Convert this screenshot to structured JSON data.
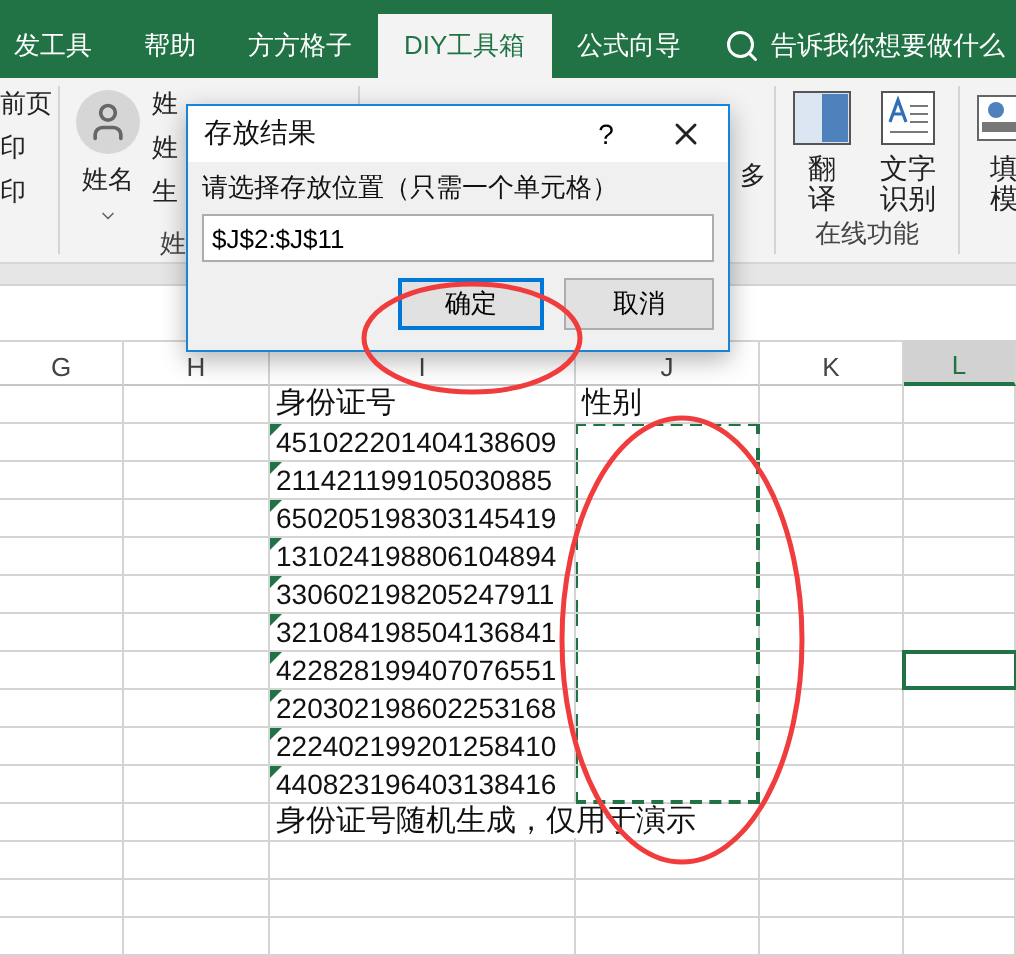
{
  "ribbon_tabs": [
    {
      "label": "发工具",
      "selected": false
    },
    {
      "label": "帮助",
      "selected": false
    },
    {
      "label": "方方格子",
      "selected": false
    },
    {
      "label": "DIY工具箱",
      "selected": true
    },
    {
      "label": "公式向导",
      "selected": false
    }
  ],
  "search": {
    "placeholder": "告诉我你想要做什么"
  },
  "ribbon": {
    "left_items": [
      "前页",
      "印",
      "印"
    ],
    "name_button": "姓名",
    "name_items": [
      "姓",
      "姓",
      "生"
    ],
    "name_group": "姓",
    "more_label": "多",
    "online_buttons": [
      {
        "label": "翻译",
        "kind": "translate"
      },
      {
        "label": "文字识别",
        "kind": "ocr"
      }
    ],
    "online_group": "在线功能",
    "fill_button": "填模"
  },
  "sheet": {
    "columns": [
      {
        "label": "G",
        "selected": false
      },
      {
        "label": "H",
        "selected": false
      },
      {
        "label": "I",
        "selected": false
      },
      {
        "label": "J",
        "selected": false
      },
      {
        "label": "K",
        "selected": false
      },
      {
        "label": "L",
        "selected": true
      }
    ],
    "rows": [
      {
        "I": "身份证号",
        "J": "性别",
        "text_number": false,
        "marquee": false,
        "active": false
      },
      {
        "I": "451022201404138609",
        "text_number": true,
        "marquee": true,
        "active": false
      },
      {
        "I": "211421199105030885",
        "text_number": true,
        "marquee": true,
        "active": false
      },
      {
        "I": "650205198303145419",
        "text_number": true,
        "marquee": true,
        "active": false
      },
      {
        "I": "131024198806104894",
        "text_number": true,
        "marquee": true,
        "active": false
      },
      {
        "I": "330602198205247911",
        "text_number": true,
        "marquee": true,
        "active": false
      },
      {
        "I": "321084198504136841",
        "text_number": true,
        "marquee": true,
        "active": false
      },
      {
        "I": "422828199407076551",
        "text_number": true,
        "marquee": true,
        "active": true
      },
      {
        "I": "220302198602253168",
        "text_number": true,
        "marquee": true,
        "active": false
      },
      {
        "I": "222402199201258410",
        "text_number": true,
        "marquee": true,
        "active": false
      },
      {
        "I": "440823196403138416",
        "text_number": true,
        "marquee": true,
        "active": false
      },
      {
        "I": "身份证号随机生成，仅用于演示",
        "text_number": false,
        "marquee": false,
        "active": false
      }
    ]
  },
  "dialog": {
    "title": "存放结果",
    "help": "?",
    "prompt": "请选择存放位置（只需一个单元格）",
    "value": "$J$2:$J$11",
    "buttons": [
      {
        "label": "确定",
        "focused": true
      },
      {
        "label": "取消",
        "focused": false
      }
    ]
  }
}
